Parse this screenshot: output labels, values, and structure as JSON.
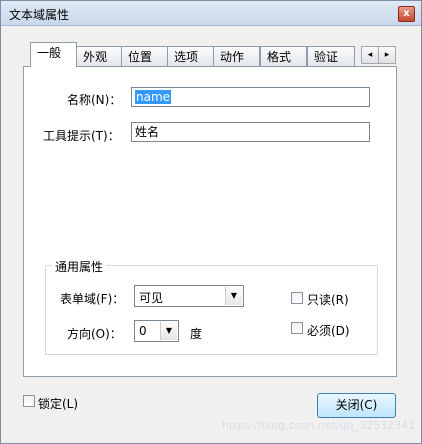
{
  "window": {
    "title": "文本域属性",
    "close_glyph": "x"
  },
  "tabs": [
    {
      "label": "一般"
    },
    {
      "label": "外观"
    },
    {
      "label": "位置"
    },
    {
      "label": "选项"
    },
    {
      "label": "动作"
    },
    {
      "label": "格式"
    },
    {
      "label": "验证"
    }
  ],
  "tab_scroll": {
    "left": "◂",
    "right": "▸"
  },
  "fields": {
    "name_label": "名称(N)：",
    "name_value": "name",
    "tooltip_label": "工具提示(T)：",
    "tooltip_value": "姓名"
  },
  "common": {
    "group_title": "通用属性",
    "form_field_label": "表单域(F)：",
    "form_field_value": "可见",
    "direction_label": "方向(O)：",
    "direction_value": "0",
    "degree_unit": "度",
    "readonly_label": "只读(R)",
    "required_label": "必须(D)"
  },
  "footer": {
    "lock_label": "锁定(L)",
    "close_button": "关闭(C)",
    "watermark": "https://blog.csdn.net/qq_32532341"
  }
}
